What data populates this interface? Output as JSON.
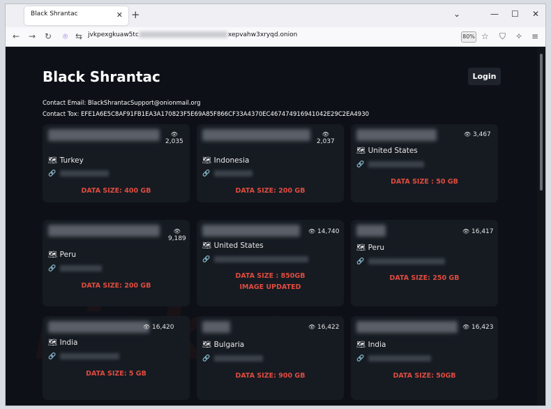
{
  "browser": {
    "tab_title": "Black Shrantac",
    "url_prefix": "jvkpexgkuaw5tc",
    "url_suffix": "xepvahw3xryqd.onion",
    "zoom": "80%"
  },
  "page": {
    "title": "Black Shrantac",
    "login_label": "Login",
    "contact_email": "Contact Email: BlackShrantacSupport@onionmail.org",
    "contact_tox": "Contact Tox: EFE1A6E5C8AF91FB1EA3A170823F5E69A85F866CF33A4370EC467474916941042E29C2EA4930"
  },
  "cards": [
    {
      "views": "2,035",
      "country": "Turkey",
      "size_lines": [
        "DATA SIZE: 400 GB"
      ]
    },
    {
      "views": "2,037",
      "country": "Indonesia",
      "size_lines": [
        "DATA SIZE: 200 GB"
      ]
    },
    {
      "views": "3,467",
      "country": "United States",
      "size_lines": [
        "DATA SIZE : 50 GB"
      ]
    },
    {
      "views": "9,189",
      "country": "Peru",
      "size_lines": [
        "DATA SIZE: 200 GB"
      ]
    },
    {
      "views": "14,740",
      "country": "United States",
      "size_lines": [
        "DATA SIZE : 850GB",
        "IMAGE UPDATED"
      ]
    },
    {
      "views": "16,417",
      "country": "Peru",
      "size_lines": [
        "DATA SIZE: 250 GB"
      ]
    },
    {
      "views": "16,420",
      "country": "India",
      "size_lines": [
        "DATA SIZE: 5 GB"
      ]
    },
    {
      "views": "16,422",
      "country": "Bulgaria",
      "size_lines": [
        "DATA SIZE: 900 GB"
      ]
    },
    {
      "views": "16,423",
      "country": "India",
      "size_lines": [
        "DATA SIZE: 50GB"
      ]
    }
  ]
}
